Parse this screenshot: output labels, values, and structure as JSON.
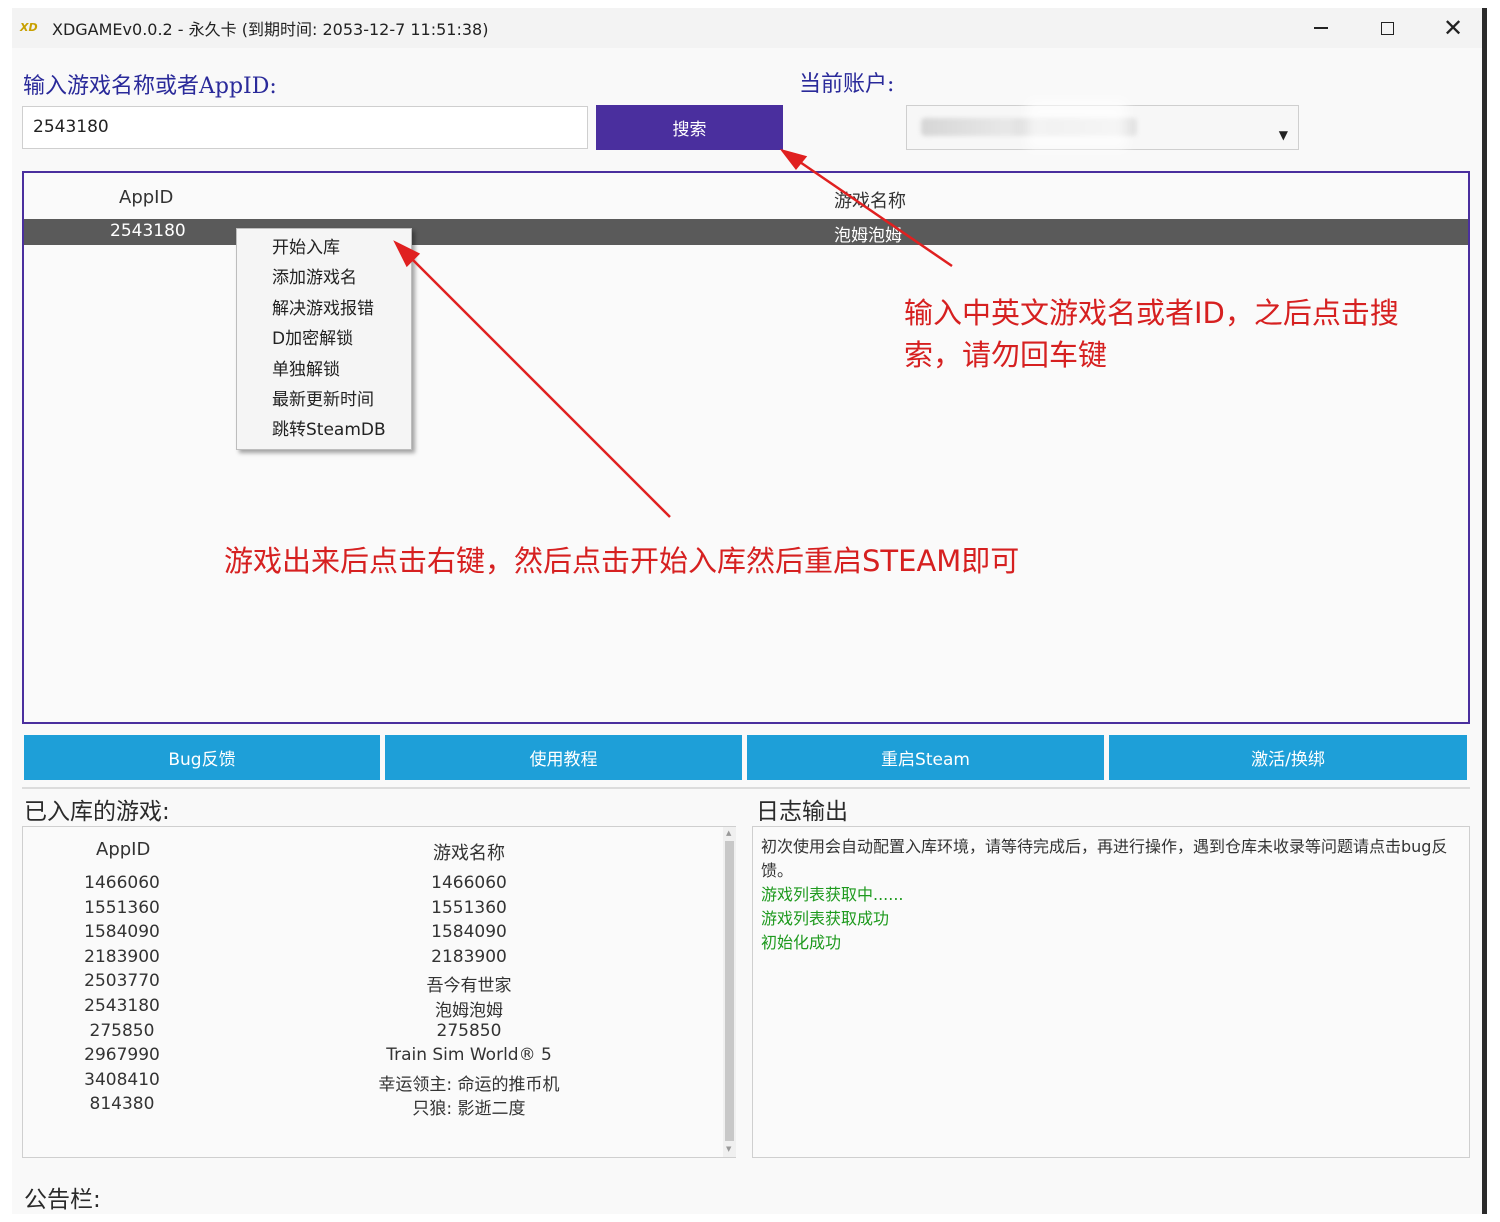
{
  "window": {
    "title": "XDGAMEv0.0.2 - 永久卡 (到期时间: 2053-12-7 11:51:38)",
    "app_icon_text": "XD"
  },
  "search": {
    "label": "输入游戏名称或者AppID:",
    "value": "2543180",
    "button_label": "搜索"
  },
  "account": {
    "label": "当前账户:",
    "selected_value": ""
  },
  "results": {
    "columns": [
      "AppID",
      "游戏名称"
    ],
    "rows": [
      {
        "appid": "2543180",
        "name": "泡姆泡姆"
      }
    ]
  },
  "context_menu": {
    "items": [
      "开始入库",
      "添加游戏名",
      "解决游戏报错",
      "D加密解锁",
      "单独解锁",
      "最新更新时间",
      "跳转SteamDB"
    ]
  },
  "annotations": {
    "search_hint_line1": "输入中英文游戏名或者ID，之后点击搜",
    "search_hint_line2": "索，请勿回车键",
    "menu_hint": "游戏出来后点击右键，然后点击开始入库然后重启STEAM即可"
  },
  "actions": {
    "bug_feedback": "Bug反馈",
    "tutorial": "使用教程",
    "restart_steam": "重启Steam",
    "activate": "激活/换绑"
  },
  "owned": {
    "label": "已入库的游戏:",
    "columns": [
      "AppID",
      "游戏名称"
    ],
    "rows": [
      {
        "appid": "1466060",
        "name": "1466060"
      },
      {
        "appid": "1551360",
        "name": "1551360"
      },
      {
        "appid": "1584090",
        "name": "1584090"
      },
      {
        "appid": "2183900",
        "name": "2183900"
      },
      {
        "appid": "2503770",
        "name": "吾今有世家"
      },
      {
        "appid": "2543180",
        "name": "泡姆泡姆"
      },
      {
        "appid": "275850",
        "name": "275850"
      },
      {
        "appid": "2967990",
        "name": "Train Sim World® 5"
      },
      {
        "appid": "3408410",
        "name": "幸运领主: 命运的推币机"
      },
      {
        "appid": "814380",
        "name": "只狼: 影逝二度"
      }
    ]
  },
  "log": {
    "label": "日志输出",
    "lines": [
      {
        "text": "初次使用会自动配置入库环境，请等待完成后，再进行操作，遇到仓库未收录等问题请点击bug反馈。",
        "color": "#333333"
      },
      {
        "text": "游戏列表获取中......",
        "color": "#1e9a1e"
      },
      {
        "text": "游戏列表获取成功",
        "color": "#1e9a1e"
      },
      {
        "text": "初始化成功",
        "color": "#1e9a1e"
      }
    ]
  },
  "bulletin": {
    "label": "公告栏:"
  },
  "colors": {
    "accent_purple": "#4a2f9e",
    "action_blue": "#1e9fd8",
    "annotation_red": "#d62020",
    "log_green": "#1e9a1e"
  }
}
